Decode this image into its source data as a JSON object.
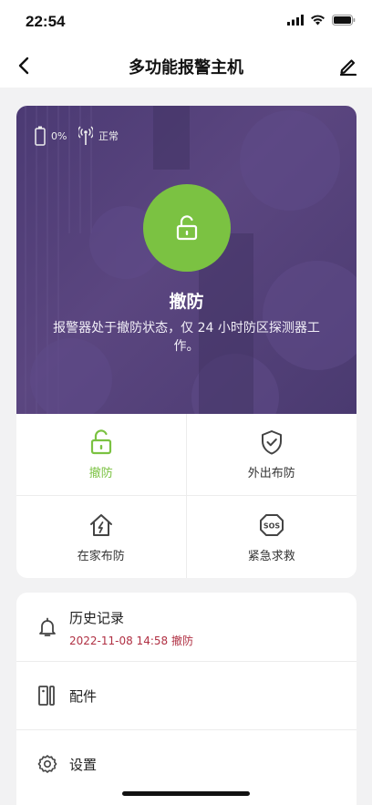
{
  "status_bar": {
    "time": "22:54"
  },
  "nav": {
    "title": "多功能报警主机"
  },
  "device": {
    "battery_text": "0%",
    "signal_text": "正常",
    "state_title": "撤防",
    "state_description": "报警器处于撤防状态，仅 24 小时防区探测器工作。"
  },
  "modes": [
    {
      "label": "撤防",
      "icon": "unlock-icon",
      "active": true
    },
    {
      "label": "外出布防",
      "icon": "shield-check-icon",
      "active": false
    },
    {
      "label": "在家布防",
      "icon": "home-arm-icon",
      "active": false
    },
    {
      "label": "紧急求救",
      "icon": "sos-icon",
      "active": false
    }
  ],
  "list": {
    "history": {
      "label": "历史记录",
      "latest": "2022-11-08 14:58 撤防"
    },
    "accessories": {
      "label": "配件"
    },
    "settings": {
      "label": "设置"
    }
  },
  "colors": {
    "accent_green": "#7bc242",
    "hero_purple": "#4b3a73",
    "history_red": "#b03043"
  }
}
